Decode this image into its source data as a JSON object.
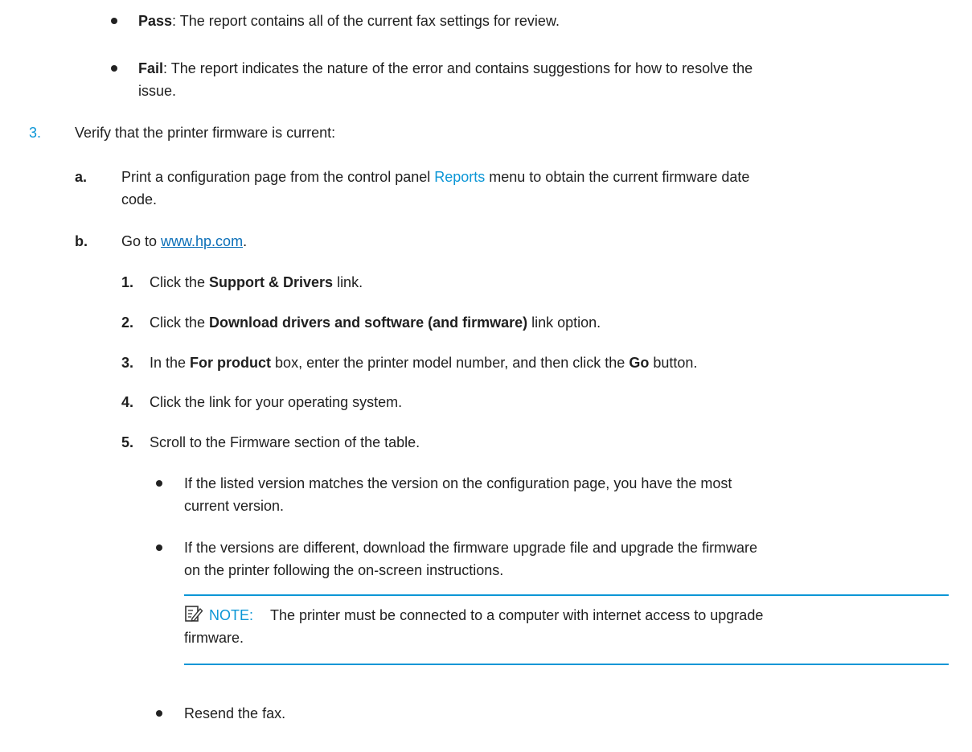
{
  "top_bullets": [
    {
      "term": "Pass",
      "text": ": The report contains all of the current fax settings for review."
    },
    {
      "term": "Fail",
      "text_line1": ": The report indicates the nature of the error and contains suggestions for how to resolve the",
      "text_line2": "issue."
    }
  ],
  "step3": {
    "number": "3.",
    "text": "Verify that the printer firmware is current:",
    "sub_a": {
      "letter": "a.",
      "line1_before": "Print a configuration page from the control panel ",
      "line1_link": "Reports",
      "line1_after": " menu to obtain the current firmware date",
      "line2": "code."
    },
    "sub_b": {
      "letter": "b.",
      "before": "Go to ",
      "link": "www.hp.com",
      "after": "."
    },
    "items": [
      {
        "num": "1.",
        "before": "Click the ",
        "bold": "Support & Drivers",
        "after": " link."
      },
      {
        "num": "2.",
        "before": "Click the ",
        "bold": "Download drivers and software (and firmware)",
        "after": " link option."
      },
      {
        "num": "3.",
        "before": "In the ",
        "bold": "For product",
        "middle": " box, enter the printer model number, and then click the ",
        "bold2": "Go",
        "after": " button."
      },
      {
        "num": "4.",
        "text": "Click the link for your operating system."
      },
      {
        "num": "5.",
        "text": "Scroll to the Firmware section of the table."
      }
    ],
    "sub_bullets": [
      {
        "line1": "If the listed version matches the version on the configuration page, you have the most",
        "line2": "current version."
      },
      {
        "line1": "If the versions are different, download the firmware upgrade file and upgrade the firmware",
        "line2": "on the printer following the on-screen instructions."
      }
    ],
    "note": {
      "label": "NOTE:",
      "line1": "The printer must be connected to a computer with internet access to upgrade",
      "line2": "firmware."
    },
    "final_bullet": "Resend the fax."
  },
  "colors": {
    "accent": "#0b96d6",
    "text": "#1f1f1f"
  }
}
